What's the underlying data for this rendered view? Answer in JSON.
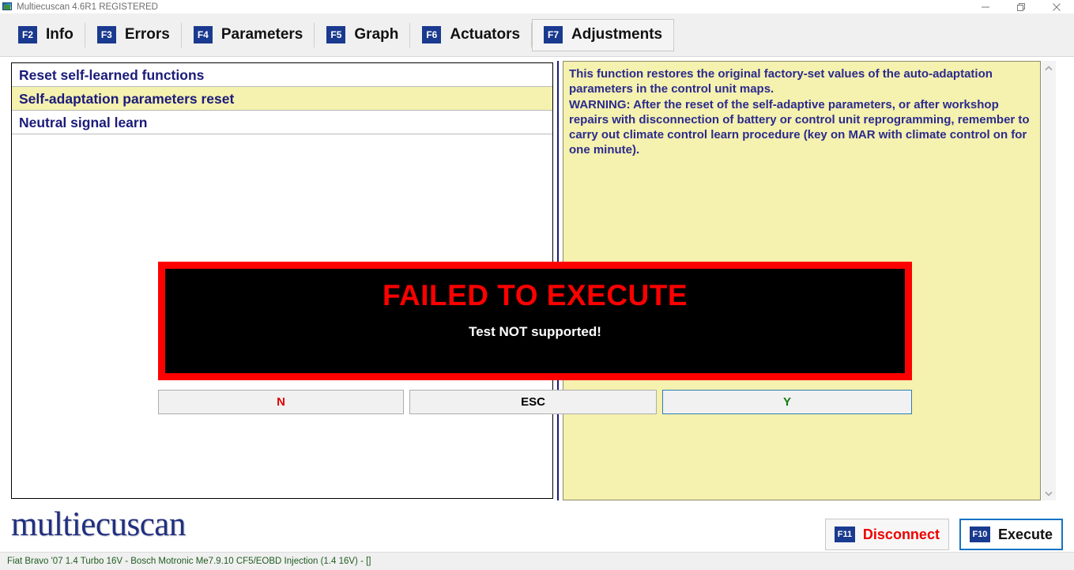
{
  "window": {
    "title": "Multiecuscan 4.6R1 REGISTERED",
    "icon": "app-icon",
    "controls": {
      "minimize": "minimize-icon",
      "maximize": "restore-icon",
      "close": "close-icon"
    }
  },
  "tabs": [
    {
      "key": "F2",
      "label": "Info",
      "selected": false
    },
    {
      "key": "F3",
      "label": "Errors",
      "selected": false
    },
    {
      "key": "F4",
      "label": "Parameters",
      "selected": false
    },
    {
      "key": "F5",
      "label": "Graph",
      "selected": false
    },
    {
      "key": "F6",
      "label": "Actuators",
      "selected": false
    },
    {
      "key": "F7",
      "label": "Adjustments",
      "selected": true
    }
  ],
  "adjustments_list": [
    {
      "label": "Reset self-learned functions",
      "selected": false
    },
    {
      "label": "Self-adaptation parameters reset",
      "selected": true
    },
    {
      "label": "Neutral signal learn",
      "selected": false
    }
  ],
  "description": {
    "text": "This function restores the original factory-set values of the auto-adaptation parameters in the control unit maps.\nWARNING: After the reset of the self-adaptive parameters, or after workshop repairs with disconnection of battery or control unit reprogramming, remember to carry out climate control learn procedure (key on MAR with climate control on for one minute)."
  },
  "scrollbar": {
    "up": "chevron-up-icon",
    "down": "chevron-down-icon"
  },
  "dialog": {
    "title": "FAILED TO EXECUTE",
    "subtitle": "Test NOT supported!",
    "buttons": [
      {
        "label": "N",
        "color": "#e60000",
        "focused": false
      },
      {
        "label": "ESC",
        "color": "#000000",
        "focused": false
      },
      {
        "label": "Y",
        "color": "#0f7a0f",
        "focused": true
      }
    ]
  },
  "footer": {
    "logo": "multiecuscan",
    "buttons": [
      {
        "key": "F11",
        "label": "Disconnect",
        "color": "#ee0000",
        "focused": false
      },
      {
        "key": "F10",
        "label": "Execute",
        "color": "#111111",
        "focused": true
      }
    ]
  },
  "statusbar": {
    "text": "Fiat Bravo '07 1.4 Turbo 16V - Bosch Motronic Me7.9.10 CF5/EOBD Injection (1.4 16V) - []"
  },
  "colors": {
    "accent_blue": "#1a3a8f",
    "panel_yellow": "#f5f1af",
    "alert_red": "#fe0000",
    "list_text": "#1b1b7a",
    "status_green": "#1f5c1f"
  }
}
